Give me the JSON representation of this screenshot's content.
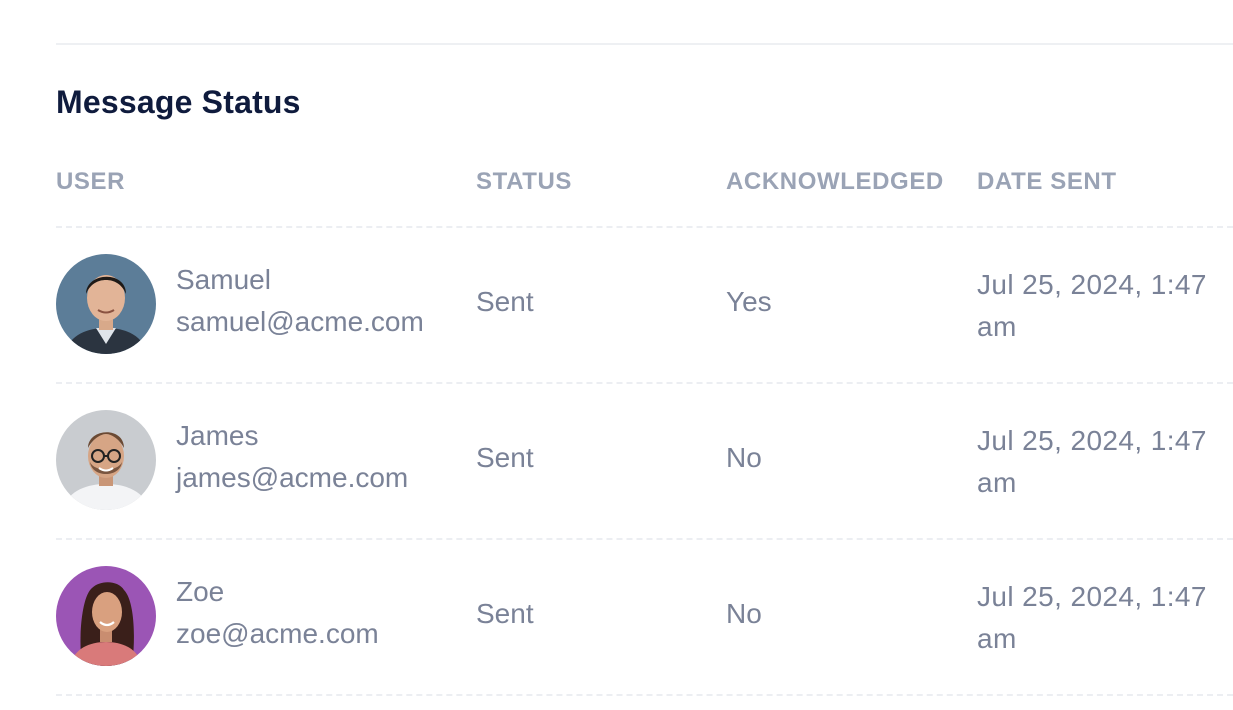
{
  "section": {
    "title": "Message Status"
  },
  "table": {
    "headers": {
      "user": "USER",
      "status": "STATUS",
      "acknowledged": "ACKNOWLEDGED",
      "date_sent": "DATE SENT"
    },
    "rows": [
      {
        "name": "Samuel",
        "email": "samuel@acme.com",
        "status": "Sent",
        "acknowledged": "Yes",
        "date_sent": "Jul 25, 2024, 1:47 am"
      },
      {
        "name": "James",
        "email": "james@acme.com",
        "status": "Sent",
        "acknowledged": "No",
        "date_sent": "Jul 25, 2024, 1:47 am"
      },
      {
        "name": "Zoe",
        "email": "zoe@acme.com",
        "status": "Sent",
        "acknowledged": "No",
        "date_sent": "Jul 25, 2024, 1:47 am"
      }
    ]
  },
  "colors": {
    "title": "#0f1b3d",
    "header_text": "#9aa3b5",
    "body_text": "#7a8297",
    "divider": "#eceef2"
  }
}
